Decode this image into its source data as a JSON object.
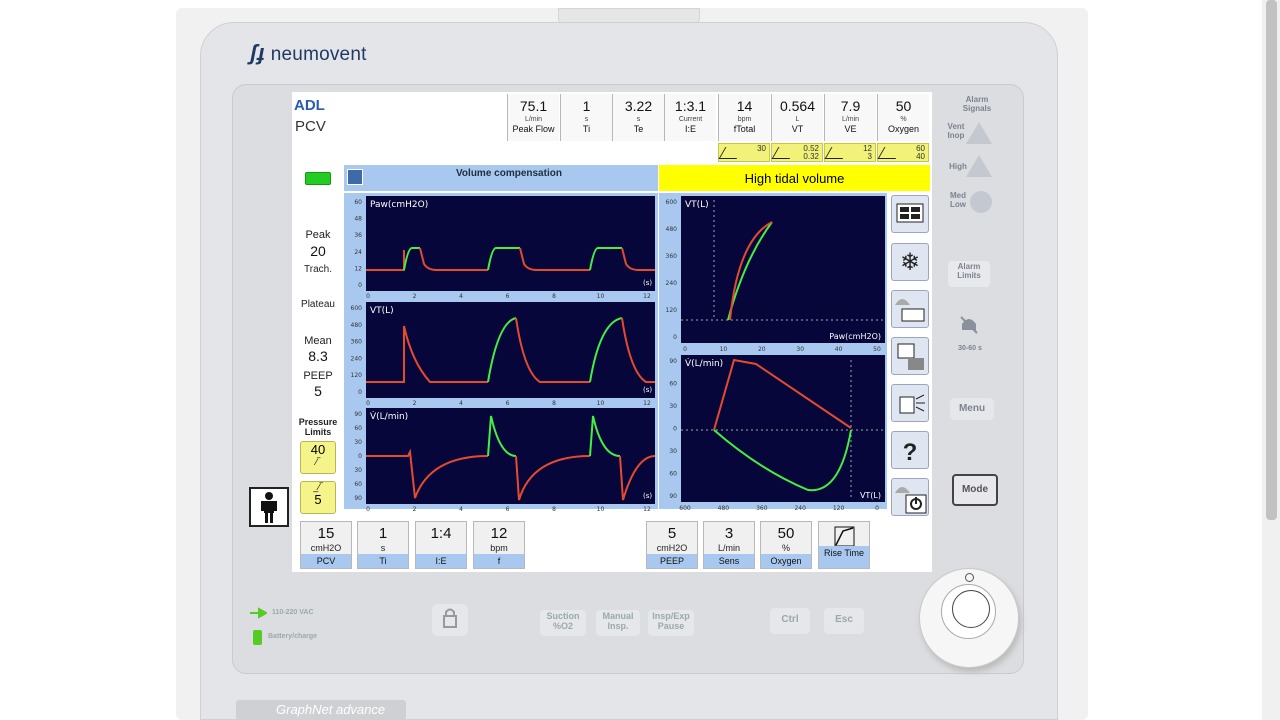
{
  "brand": "neumovent",
  "model_label": "GraphNet advance",
  "mode": {
    "group": "ADL",
    "mode": "PCV"
  },
  "monitor_cells": [
    {
      "value": "75.1",
      "unit": "L/min",
      "name": "Peak Flow"
    },
    {
      "value": "1",
      "unit": "s",
      "name": "Ti"
    },
    {
      "value": "3.22",
      "unit": "s",
      "name": "Te"
    },
    {
      "value": "1:3.1",
      "unit": "Current",
      "name": "I:E"
    },
    {
      "value": "14",
      "unit": "bpm",
      "name": "fTotal"
    },
    {
      "value": "0.564",
      "unit": "L",
      "name": "VT"
    },
    {
      "value": "7.9",
      "unit": "L/min",
      "name": "VE"
    },
    {
      "value": "50",
      "unit": "%",
      "name": "Oxygen"
    }
  ],
  "limit_cells": [
    {
      "high": "30",
      "low": ""
    },
    {
      "high": "0.52",
      "low": "0.32"
    },
    {
      "high": "12",
      "low": "3"
    },
    {
      "high": "60",
      "low": "40"
    }
  ],
  "message_bar": "Volume compensation",
  "alarm_message": "High tidal volume",
  "left_panel": {
    "peak_label": "Peak",
    "peak_value": "20",
    "trach_label": "Trach.",
    "plateau_label": "Plateau",
    "mean_label": "Mean",
    "mean_value": "8.3",
    "peep_label": "PEEP",
    "peep_value": "5",
    "pressure_limits_label": "Pressure Limits",
    "upper_limit": "40",
    "lower_limit": "5"
  },
  "waveforms": [
    {
      "title": "Paw(cmH2O)",
      "y_ticks": [
        "60",
        "48",
        "36",
        "24",
        "12",
        "0"
      ],
      "x_ticks": [
        "0",
        "2",
        "4",
        "6",
        "8",
        "10",
        "12"
      ],
      "x_unit": "(s)"
    },
    {
      "title": "VT(L)",
      "y_ticks": [
        "600",
        "480",
        "360",
        "240",
        "120",
        "0"
      ],
      "x_ticks": [
        "0",
        "2",
        "4",
        "6",
        "8",
        "10",
        "12"
      ],
      "x_unit": "(s)"
    },
    {
      "title": "V̇(L/min)",
      "y_ticks": [
        "90",
        "60",
        "30",
        "0",
        "30",
        "60",
        "90"
      ],
      "x_ticks": [
        "0",
        "2",
        "4",
        "6",
        "8",
        "10",
        "12"
      ],
      "x_unit": "(s)"
    }
  ],
  "loops": [
    {
      "title": "VT(L)",
      "x_title": "Paw(cmH2O)",
      "y_ticks": [
        "600",
        "480",
        "360",
        "240",
        "120",
        "0"
      ],
      "x_ticks": [
        "0",
        "10",
        "20",
        "30",
        "40",
        "50"
      ]
    },
    {
      "title": "V̇(L/min)",
      "x_title": "VT(L)",
      "y_ticks": [
        "90",
        "60",
        "30",
        "0",
        "30",
        "60",
        "90"
      ],
      "x_ticks": [
        "600",
        "480",
        "360",
        "240",
        "120",
        "0"
      ]
    }
  ],
  "settings_left": [
    {
      "value": "15",
      "unit": "cmH2O",
      "name": "PCV"
    },
    {
      "value": "1",
      "unit": "s",
      "name": "Ti"
    },
    {
      "value": "1:4",
      "unit": "",
      "name": "I:E"
    },
    {
      "value": "12",
      "unit": "bpm",
      "name": "f"
    }
  ],
  "settings_right": [
    {
      "value": "5",
      "unit": "cmH2O",
      "name": "PEEP"
    },
    {
      "value": "3",
      "unit": "L/min",
      "name": "Sens"
    },
    {
      "value": "50",
      "unit": "%",
      "name": "Oxygen"
    },
    {
      "value": "",
      "unit": "",
      "name": "Rise Time"
    }
  ],
  "right_panel": {
    "alarm_signals": "Alarm Signals",
    "vent_inop": "Vent Inop",
    "high": "High",
    "med_low": "Med Low",
    "alarm_limits": "Alarm Limits",
    "silence_time": "30-60 s",
    "menu": "Menu",
    "mode": "Mode"
  },
  "hw_buttons": {
    "power": "110-220 VAC",
    "battery": "Battery/charge",
    "suction": "Suction %O2",
    "manual": "Manual Insp.",
    "pause": "Insp/Exp Pause",
    "ctrl": "Ctrl",
    "esc": "Esc"
  },
  "colors": {
    "alarm_yellow": "#ffff00",
    "plot_bg": "#06063a",
    "insp_green": "#44ee44",
    "exp_red": "#e64a2e",
    "panel_blue": "#a8c8ef"
  }
}
